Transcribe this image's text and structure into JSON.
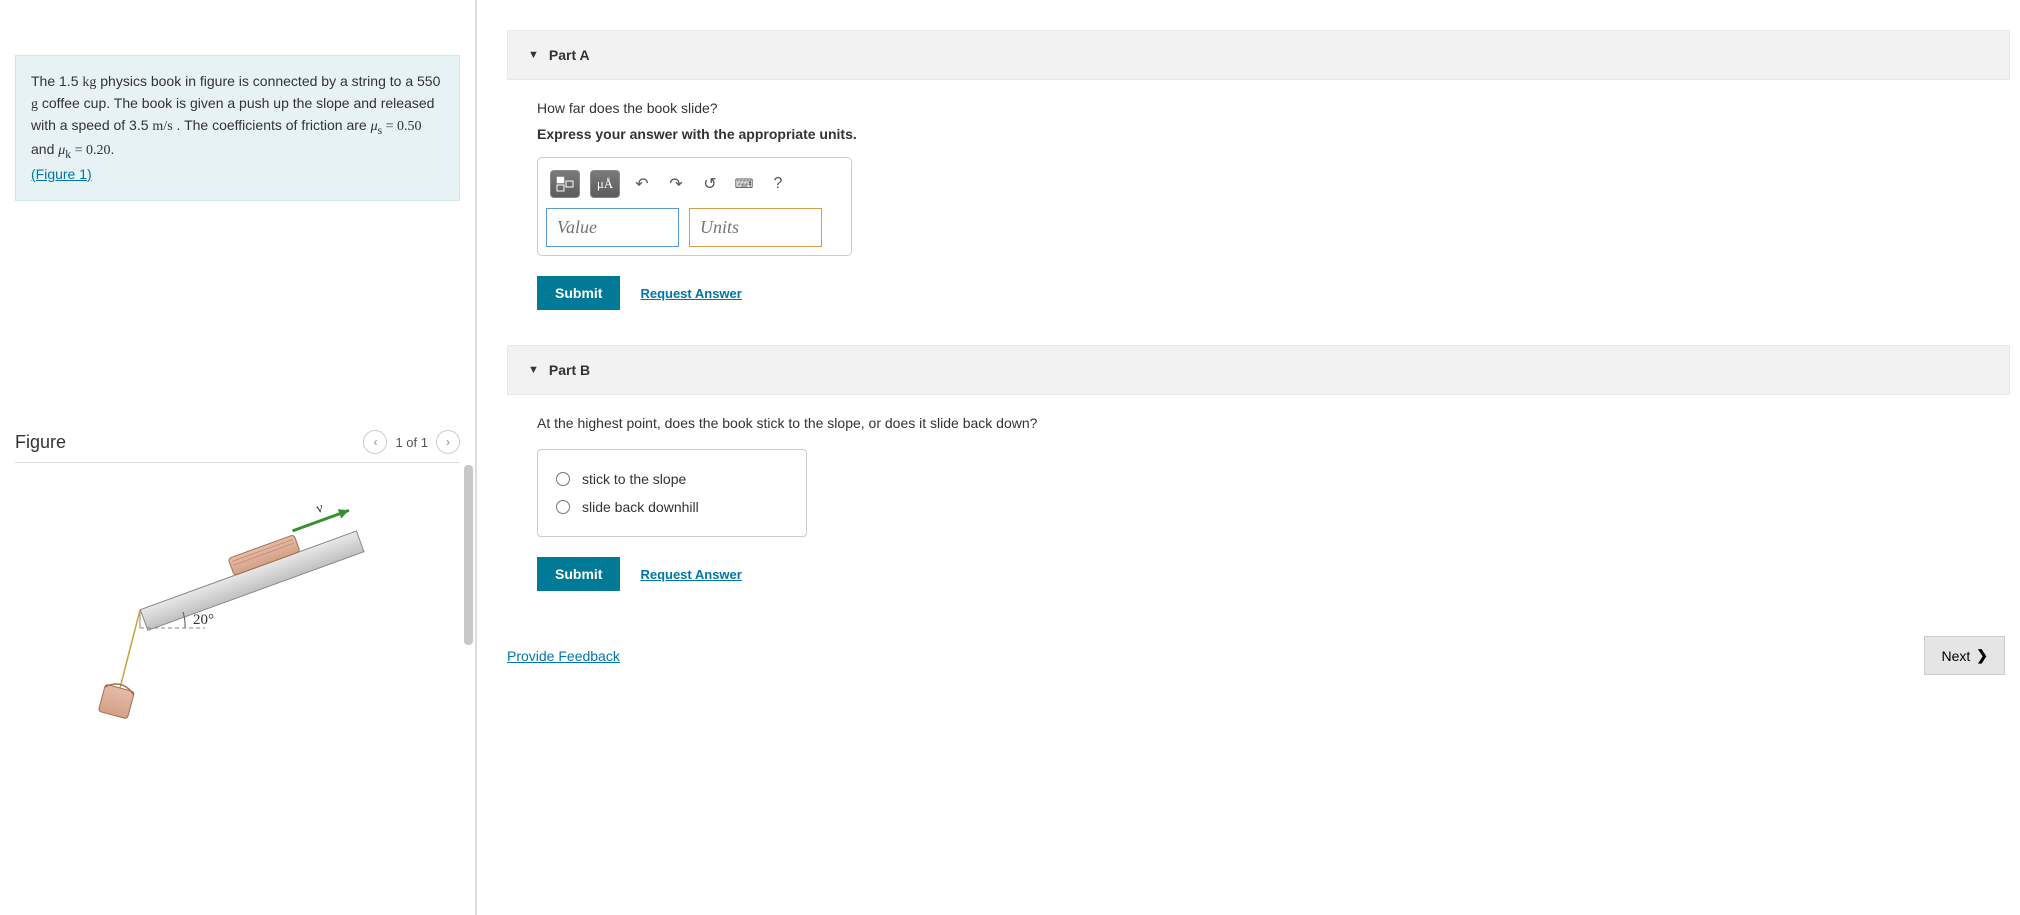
{
  "problem": {
    "text1": "The 1.5 ",
    "mass_unit": "kg",
    "text2": " physics book in figure is connected by a string to a 550 ",
    "mass2_unit": "g",
    "text3": " coffee cup. The book is given a push up the slope and released with a speed of 3.5 ",
    "speed_unit": "m/s",
    "text4": " . The coefficients of friction are ",
    "mu_s": "μ",
    "mu_s_sub": "s",
    "eq1": " = 0.50",
    "and": " and ",
    "mu_k": "μ",
    "mu_k_sub": "k",
    "eq2": " = 0.20",
    "figure_link": "(Figure 1)"
  },
  "figure": {
    "title": "Figure",
    "nav_text": "1 of 1",
    "angle": "20°",
    "velocity_label": "v⃗"
  },
  "partA": {
    "header": "Part A",
    "question": "How far does the book slide?",
    "instruction": "Express your answer with the appropriate units.",
    "value_placeholder": "Value",
    "units_placeholder": "Units",
    "mu_a": "μÅ",
    "submit": "Submit",
    "request": "Request Answer"
  },
  "partB": {
    "header": "Part B",
    "question": "At the highest point, does the book stick to the slope, or does it slide back down?",
    "option1": "stick to the slope",
    "option2": "slide back downhill",
    "submit": "Submit",
    "request": "Request Answer"
  },
  "footer": {
    "feedback": "Provide Feedback",
    "next": "Next"
  }
}
